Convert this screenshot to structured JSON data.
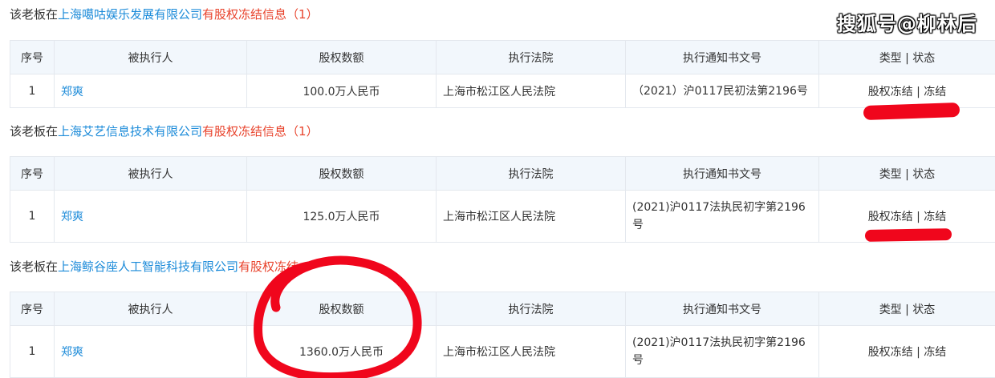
{
  "sections": [
    {
      "heading_prefix": "该老板在",
      "company": "上海噶咕娱乐发展有限公司",
      "heading_suffix": "有股权冻结信息",
      "count_text": "（1）",
      "headers": [
        "序号",
        "被执行人",
        "股权数额",
        "执行法院",
        "执行通知书文号",
        "类型 | 状态"
      ],
      "rows": [
        {
          "index": "1",
          "person": "郑爽",
          "amount": "100.0万人民币",
          "court": "上海市松江区人民法院",
          "notice": "（2021）沪0117民初法第2196号",
          "type_status": "股权冻结 | 冻结"
        }
      ]
    },
    {
      "heading_prefix": "该老板在",
      "company": "上海艾艺信息技术有限公司",
      "heading_suffix": "有股权冻结信息",
      "count_text": "（1）",
      "headers": [
        "序号",
        "被执行人",
        "股权数额",
        "执行法院",
        "执行通知书文号",
        "类型 | 状态"
      ],
      "rows": [
        {
          "index": "1",
          "person": "郑爽",
          "amount": "125.0万人民币",
          "court": "上海市松江区人民法院",
          "notice": "(2021)沪0117法执民初字第2196号",
          "type_status": "股权冻结 | 冻结"
        }
      ]
    },
    {
      "heading_prefix": "该老板在",
      "company": "上海鲸谷座人工智能科技有限公司",
      "heading_suffix": "有股权冻结",
      "count_text": "",
      "headers": [
        "序号",
        "被执行人",
        "股权数额",
        "执行法院",
        "执行通知书文号",
        "类型 | 状态"
      ],
      "rows": [
        {
          "index": "1",
          "person": "郑爽",
          "amount": "1360.0万人民币",
          "court": "上海市松江区人民法院",
          "notice": "(2021)沪0117法执民初字第2196号",
          "type_status": "股权冻结 | 冻结"
        }
      ]
    }
  ],
  "watermark": "搜狐号@柳林后",
  "colors": {
    "link": "#1c8bd9",
    "highlight": "#e8432c",
    "header_bg": "#f2f7fc",
    "border": "#e4e8ee",
    "annotation": "#f0061c"
  }
}
